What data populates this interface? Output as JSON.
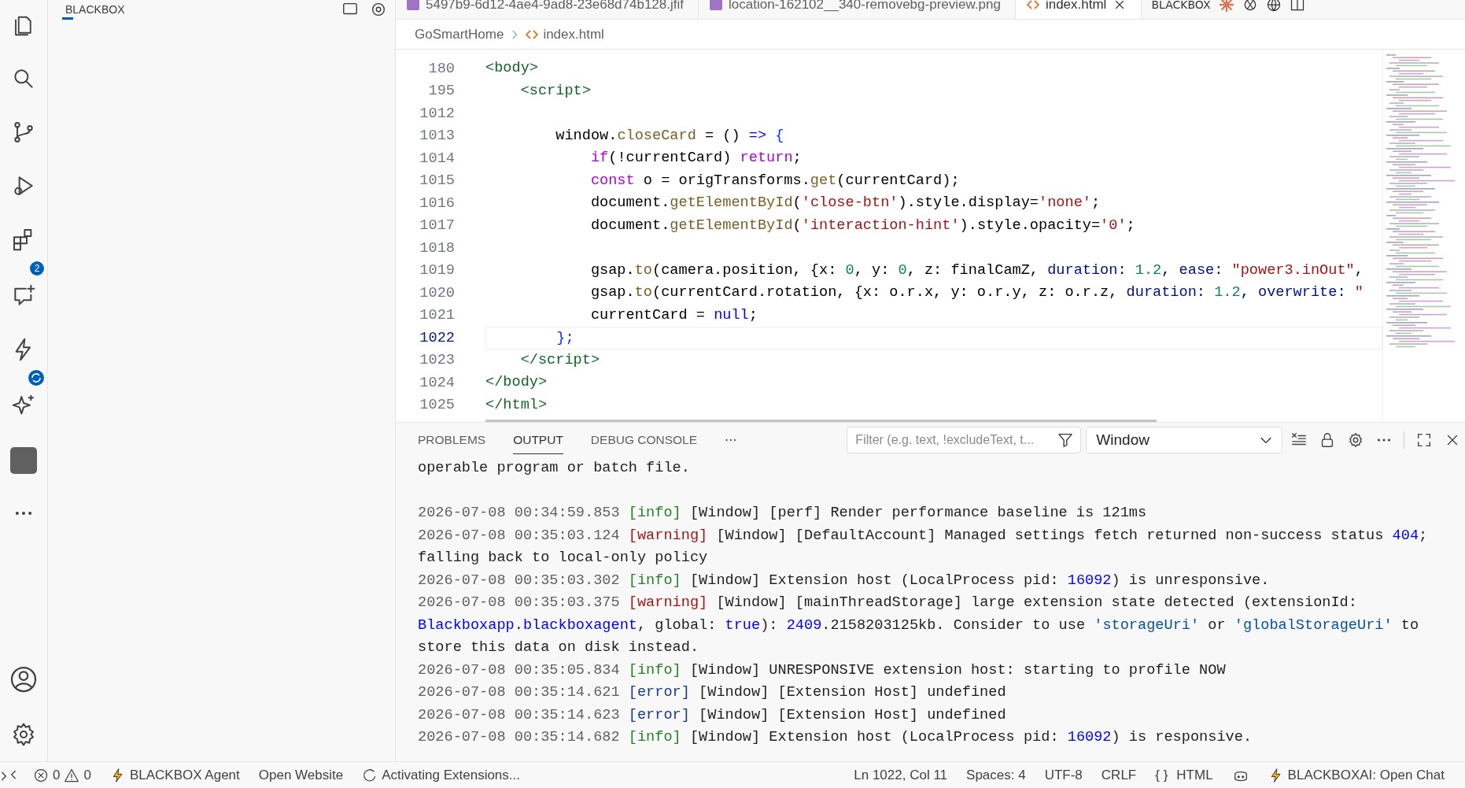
{
  "activity_bar": {
    "extensions_badge": "2"
  },
  "sidebar": {
    "title": "BLACKBOX"
  },
  "tabs": [
    {
      "label": "5497b9-6d12-4ae4-9ad8-23e68d74b128.jfif",
      "kind": "image",
      "selected": false
    },
    {
      "label": "location-162102__340-removebg-preview.png",
      "kind": "image",
      "selected": false
    },
    {
      "label": "index.html",
      "kind": "html",
      "selected": true
    }
  ],
  "tab_bar_extra": {
    "label": "BLACKBOX"
  },
  "breadcrumb": [
    "GoSmartHome",
    "index.html"
  ],
  "code": [
    {
      "number": "180",
      "current": false,
      "tokens": [
        {
          "text": "<body>",
          "kind": "tag"
        }
      ]
    },
    {
      "number": "195",
      "current": false,
      "tokens": [
        {
          "text": "    <script>",
          "kind": "tag"
        }
      ]
    },
    {
      "number": "1012",
      "current": false
    },
    {
      "number": "1013",
      "current": false,
      "tokens": [
        {
          "text": "        window.",
          "kind": "plain"
        },
        {
          "text": "closeCard",
          "kind": "function"
        },
        {
          "text": " = () ",
          "kind": "plain"
        },
        {
          "text": "=>",
          "kind": "operator"
        },
        {
          "text": " {",
          "kind": "bracket"
        }
      ]
    },
    {
      "number": "1014",
      "current": false,
      "tokens": [
        {
          "text": "            if",
          "kind": "keyword"
        },
        {
          "text": "(!currentCard) ",
          "kind": "plain"
        },
        {
          "text": "return",
          "kind": "keyword"
        },
        {
          "text": ";",
          "kind": "plain"
        }
      ]
    },
    {
      "number": "1015",
      "current": false,
      "tokens": [
        {
          "text": "            const",
          "kind": "keyword"
        },
        {
          "text": " o = origTransforms.",
          "kind": "plain"
        },
        {
          "text": "get",
          "kind": "function"
        },
        {
          "text": "(currentCard);",
          "kind": "plain"
        }
      ]
    },
    {
      "number": "1016",
      "current": false,
      "tokens": [
        {
          "text": "            document.",
          "kind": "plain"
        },
        {
          "text": "getElementById",
          "kind": "function"
        },
        {
          "text": "(",
          "kind": "plain"
        },
        {
          "text": "'close-btn'",
          "kind": "string"
        },
        {
          "text": ").style.display=",
          "kind": "plain"
        },
        {
          "text": "'none'",
          "kind": "string"
        },
        {
          "text": ";",
          "kind": "plain"
        }
      ]
    },
    {
      "number": "1017",
      "current": false,
      "tokens": [
        {
          "text": "            document.",
          "kind": "plain"
        },
        {
          "text": "getElementById",
          "kind": "function"
        },
        {
          "text": "(",
          "kind": "plain"
        },
        {
          "text": "'interaction-hint'",
          "kind": "string"
        },
        {
          "text": ").style.opacity=",
          "kind": "plain"
        },
        {
          "text": "'0'",
          "kind": "string"
        },
        {
          "text": ";",
          "kind": "plain"
        }
      ]
    },
    {
      "number": "1018",
      "current": false
    },
    {
      "number": "1019",
      "current": false,
      "tokens": [
        {
          "text": "            gsap.",
          "kind": "plain"
        },
        {
          "text": "to",
          "kind": "function"
        },
        {
          "text": "(camera.position, {x: ",
          "kind": "plain"
        },
        {
          "text": "0",
          "kind": "number"
        },
        {
          "text": ", y: ",
          "kind": "plain"
        },
        {
          "text": "0",
          "kind": "number"
        },
        {
          "text": ", z: finalCamZ, ",
          "kind": "plain"
        },
        {
          "text": "duration: ",
          "kind": "property"
        },
        {
          "text": "1.2",
          "kind": "number"
        },
        {
          "text": ", ",
          "kind": "plain"
        },
        {
          "text": "ease: ",
          "kind": "property"
        },
        {
          "text": "\"power3.inOut\"",
          "kind": "string"
        },
        {
          "text": ",",
          "kind": "plain"
        }
      ]
    },
    {
      "number": "1020",
      "current": false,
      "tokens": [
        {
          "text": "            gsap.",
          "kind": "plain"
        },
        {
          "text": "to",
          "kind": "function"
        },
        {
          "text": "(currentCard.rotation, {x: o.r.x, y: o.r.y, z: o.r.z, ",
          "kind": "plain"
        },
        {
          "text": "duration: ",
          "kind": "property"
        },
        {
          "text": "1.2",
          "kind": "number"
        },
        {
          "text": ", ",
          "kind": "plain"
        },
        {
          "text": "overwrite: ",
          "kind": "property"
        },
        {
          "text": "\"",
          "kind": "string"
        }
      ]
    },
    {
      "number": "1021",
      "current": false,
      "tokens": [
        {
          "text": "            currentCard = ",
          "kind": "plain"
        },
        {
          "text": "null",
          "kind": "literal"
        },
        {
          "text": ";",
          "kind": "plain"
        }
      ]
    },
    {
      "number": "1022",
      "current": true,
      "tokens": [
        {
          "text": "        };",
          "kind": "bracket"
        }
      ]
    },
    {
      "number": "1023",
      "current": false,
      "tokens": [
        {
          "text": "    </script>",
          "kind": "tag"
        }
      ]
    },
    {
      "number": "1024",
      "current": false,
      "tokens": [
        {
          "text": "</body>",
          "kind": "tag"
        }
      ]
    },
    {
      "number": "1025",
      "current": false,
      "tokens": [
        {
          "text": "</html>",
          "kind": "tag"
        }
      ]
    }
  ],
  "panel": {
    "tabs": [
      {
        "label": "PROBLEMS",
        "selected": false
      },
      {
        "label": "OUTPUT",
        "selected": true
      },
      {
        "label": "DEBUG CONSOLE",
        "selected": false
      }
    ],
    "more": "···",
    "filter": {
      "placeholder": "Filter (e.g. text, !excludeText, t..."
    },
    "channel": "Window",
    "log": [
      {
        "tokens": [
          {
            "text": "operable program or batch file.",
            "kind": "plain"
          }
        ]
      },
      {
        "tokens": [
          {
            "text": "2026-07-08 00:34:59.853 ",
            "kind": "time"
          },
          {
            "text": "[info]",
            "kind": "info"
          },
          {
            "text": " [Window] [perf] Render performance baseline is 121ms",
            "kind": "plain"
          }
        ]
      },
      {
        "tokens": [
          {
            "text": "2026-07-08 00:35:03.124 ",
            "kind": "time"
          },
          {
            "text": "[warning]",
            "kind": "warning"
          },
          {
            "text": " [Window] [DefaultAccount] Managed settings fetch returned non-success status ",
            "kind": "plain"
          },
          {
            "text": "404",
            "kind": "number"
          },
          {
            "text": ";",
            "kind": "plain"
          }
        ]
      },
      {
        "tokens": [
          {
            "text": "falling back to local-only policy",
            "kind": "plain"
          }
        ]
      },
      {
        "tokens": [
          {
            "text": "2026-07-08 00:35:03.302 ",
            "kind": "time"
          },
          {
            "text": "[info]",
            "kind": "info"
          },
          {
            "text": " [Window] Extension host (LocalProcess pid: ",
            "kind": "plain"
          },
          {
            "text": "16092",
            "kind": "number"
          },
          {
            "text": ") is unresponsive.",
            "kind": "plain"
          }
        ]
      },
      {
        "tokens": [
          {
            "text": "2026-07-08 00:35:03.375 ",
            "kind": "time"
          },
          {
            "text": "[warning]",
            "kind": "warning"
          },
          {
            "text": " [Window] [mainThreadStorage] large extension state detected (extensionId:",
            "kind": "plain"
          }
        ]
      },
      {
        "tokens": [
          {
            "text": "Blackboxapp.blackboxagent",
            "kind": "number"
          },
          {
            "text": ", global: ",
            "kind": "plain"
          },
          {
            "text": "true",
            "kind": "number"
          },
          {
            "text": "): ",
            "kind": "plain"
          },
          {
            "text": "2409",
            "kind": "number"
          },
          {
            "text": ".2158203125kb. Consider to use ",
            "kind": "plain"
          },
          {
            "text": "'storageUri'",
            "kind": "string"
          },
          {
            "text": " or ",
            "kind": "plain"
          },
          {
            "text": "'globalStorageUri'",
            "kind": "string"
          },
          {
            "text": " to",
            "kind": "plain"
          }
        ]
      },
      {
        "tokens": [
          {
            "text": "store this data on disk instead.",
            "kind": "plain"
          }
        ]
      },
      {
        "tokens": [
          {
            "text": "2026-07-08 00:35:05.834 ",
            "kind": "time"
          },
          {
            "text": "[info]",
            "kind": "info"
          },
          {
            "text": " [Window] UNRESPONSIVE extension host: starting to profile NOW",
            "kind": "plain"
          }
        ]
      },
      {
        "tokens": [
          {
            "text": "2026-07-08 00:35:14.621 ",
            "kind": "time"
          },
          {
            "text": "[error]",
            "kind": "error"
          },
          {
            "text": " [Window] [Extension Host] undefined",
            "kind": "plain"
          }
        ]
      },
      {
        "tokens": [
          {
            "text": "2026-07-08 00:35:14.623 ",
            "kind": "time"
          },
          {
            "text": "[error]",
            "kind": "error"
          },
          {
            "text": " [Window] [Extension Host] undefined",
            "kind": "plain"
          }
        ]
      },
      {
        "tokens": [
          {
            "text": "2026-07-08 00:35:14.682 ",
            "kind": "time"
          },
          {
            "text": "[info]",
            "kind": "info"
          },
          {
            "text": " [Window] Extension host (LocalProcess pid: ",
            "kind": "plain"
          },
          {
            "text": "16092",
            "kind": "number"
          },
          {
            "text": ") is responsive.",
            "kind": "plain"
          }
        ]
      }
    ]
  },
  "status_bar": {
    "errors": "0",
    "warnings": "0",
    "left": [
      {
        "label": "BLACKBOX Agent",
        "kind": "bolt"
      },
      {
        "label": "Open Website",
        "kind": "text"
      },
      {
        "label": "Activating Extensions...",
        "kind": "spinner"
      }
    ],
    "right": [
      {
        "label": "Ln 1022, Col 11",
        "kind": "text"
      },
      {
        "label": "Spaces: 4",
        "kind": "text"
      },
      {
        "label": "UTF-8",
        "kind": "text"
      },
      {
        "label": "CRLF",
        "kind": "text"
      },
      {
        "label": "HTML",
        "kind": "braces",
        "icon": "{ }"
      },
      {
        "kind": "copilot"
      },
      {
        "label": "BLACKBOXAI: Open Chat",
        "kind": "bolt"
      }
    ]
  }
}
